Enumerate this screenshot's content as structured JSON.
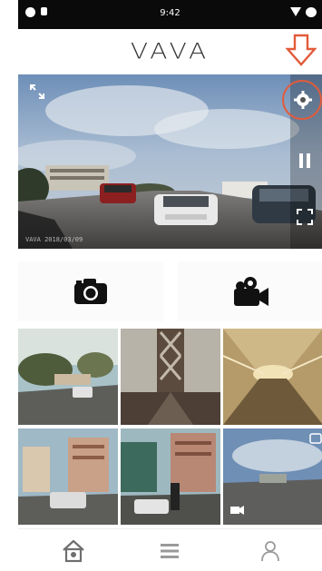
{
  "status_bar": {
    "time": "9:42"
  },
  "header": {
    "logo_text": "VAVA"
  },
  "live_view": {
    "watermark": "VAVA 2018/03/09"
  },
  "capture": {
    "photo_icon": "camera-icon",
    "video_icon": "video-camera-icon"
  },
  "gallery": {
    "items": [
      {
        "kind": "photo",
        "scene": "city-street"
      },
      {
        "kind": "photo",
        "scene": "bridge-tower"
      },
      {
        "kind": "photo",
        "scene": "tunnel"
      },
      {
        "kind": "photo",
        "scene": "downtown-street"
      },
      {
        "kind": "photo",
        "scene": "downtown-street-2"
      },
      {
        "kind": "video",
        "scene": "highway"
      }
    ]
  },
  "bottom_nav": {
    "items": [
      "home-icon",
      "list-icon",
      "profile-icon"
    ],
    "active": "home-icon"
  },
  "colors": {
    "accent": "#e25b3a",
    "nav_icon": "#8a8a8a",
    "status_bar": "#0a0a0a"
  }
}
